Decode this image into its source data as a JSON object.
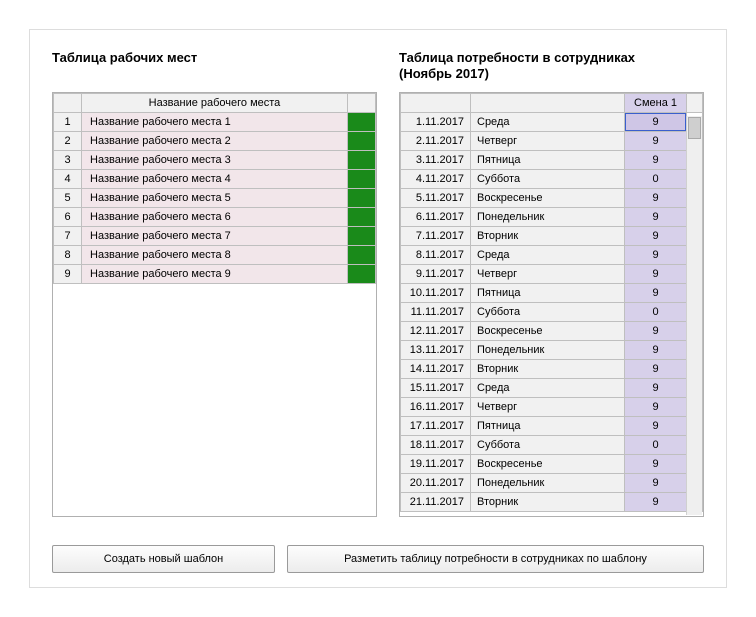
{
  "titles": {
    "workplaces": "Таблица рабочих мест",
    "need": "Таблица потребности в сотрудниках\n(Ноябрь 2017)"
  },
  "workplaces_header": "Название рабочего места",
  "workplaces_rows": [
    {
      "n": "1",
      "name": "Название рабочего места 1",
      "color": "#1a8a1a"
    },
    {
      "n": "2",
      "name": "Название рабочего места 2",
      "color": "#1a8a1a"
    },
    {
      "n": "3",
      "name": "Название рабочего места 3",
      "color": "#1a8a1a"
    },
    {
      "n": "4",
      "name": "Название рабочего места 4",
      "color": "#1a8a1a"
    },
    {
      "n": "5",
      "name": "Название рабочего места 5",
      "color": "#1a8a1a"
    },
    {
      "n": "6",
      "name": "Название рабочего места 6",
      "color": "#1a8a1a"
    },
    {
      "n": "7",
      "name": "Название рабочего места 7",
      "color": "#1a8a1a"
    },
    {
      "n": "8",
      "name": "Название рабочего места 8",
      "color": "#1a8a1a"
    },
    {
      "n": "9",
      "name": "Название рабочего места 9",
      "color": "#1a8a1a"
    }
  ],
  "need_header_shift": "Смена 1",
  "need_rows": [
    {
      "date": "1.11.2017",
      "day": "Среда",
      "shift": "9",
      "sel": true
    },
    {
      "date": "2.11.2017",
      "day": "Четверг",
      "shift": "9"
    },
    {
      "date": "3.11.2017",
      "day": "Пятница",
      "shift": "9"
    },
    {
      "date": "4.11.2017",
      "day": "Суббота",
      "shift": "0"
    },
    {
      "date": "5.11.2017",
      "day": "Воскресенье",
      "shift": "9"
    },
    {
      "date": "6.11.2017",
      "day": "Понедельник",
      "shift": "9"
    },
    {
      "date": "7.11.2017",
      "day": "Вторник",
      "shift": "9"
    },
    {
      "date": "8.11.2017",
      "day": "Среда",
      "shift": "9"
    },
    {
      "date": "9.11.2017",
      "day": "Четверг",
      "shift": "9"
    },
    {
      "date": "10.11.2017",
      "day": "Пятница",
      "shift": "9"
    },
    {
      "date": "11.11.2017",
      "day": "Суббота",
      "shift": "0"
    },
    {
      "date": "12.11.2017",
      "day": "Воскресенье",
      "shift": "9"
    },
    {
      "date": "13.11.2017",
      "day": "Понедельник",
      "shift": "9"
    },
    {
      "date": "14.11.2017",
      "day": "Вторник",
      "shift": "9"
    },
    {
      "date": "15.11.2017",
      "day": "Среда",
      "shift": "9"
    },
    {
      "date": "16.11.2017",
      "day": "Четверг",
      "shift": "9"
    },
    {
      "date": "17.11.2017",
      "day": "Пятница",
      "shift": "9"
    },
    {
      "date": "18.11.2017",
      "day": "Суббота",
      "shift": "0"
    },
    {
      "date": "19.11.2017",
      "day": "Воскресенье",
      "shift": "9"
    },
    {
      "date": "20.11.2017",
      "day": "Понедельник",
      "shift": "9"
    },
    {
      "date": "21.11.2017",
      "day": "Вторник",
      "shift": "9"
    }
  ],
  "buttons": {
    "new_template": "Создать новый шаблон",
    "apply_template": "Разметить таблицу потребности в сотрудниках по шаблону"
  }
}
